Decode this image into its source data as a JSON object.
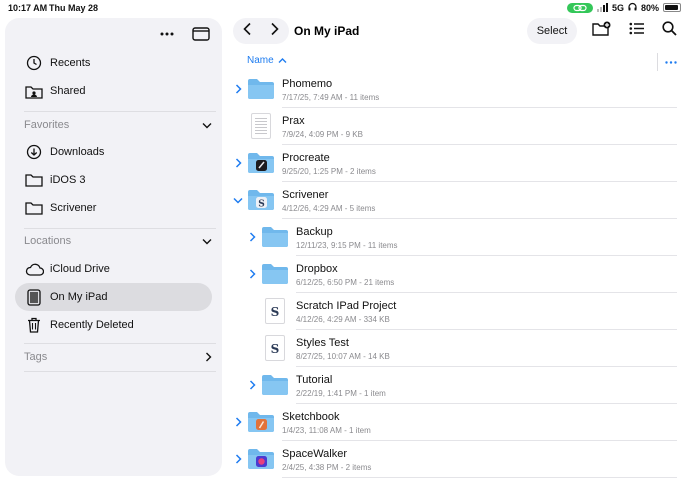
{
  "status": {
    "time": "10:17 AM",
    "date": "Thu May 28",
    "network": "5G",
    "battery": "80%"
  },
  "sidebar": {
    "items_top": [
      {
        "label": "Recents",
        "icon": "clock-icon"
      },
      {
        "label": "Shared",
        "icon": "shared-folder-icon"
      }
    ],
    "favorites": {
      "title": "Favorites",
      "items": [
        {
          "label": "Downloads",
          "icon": "download-icon"
        },
        {
          "label": "iDOS 3",
          "icon": "folder-icon"
        },
        {
          "label": "Scrivener",
          "icon": "folder-icon"
        }
      ]
    },
    "locations": {
      "title": "Locations",
      "items": [
        {
          "label": "iCloud Drive",
          "icon": "cloud-icon"
        },
        {
          "label": "On My iPad",
          "icon": "ipad-icon",
          "selected": true
        },
        {
          "label": "Recently Deleted",
          "icon": "trash-icon"
        }
      ]
    },
    "tags": {
      "title": "Tags"
    }
  },
  "header": {
    "title": "On My iPad",
    "select_label": "Select"
  },
  "sort": {
    "label": "Name"
  },
  "files": [
    {
      "name": "Phomemo",
      "meta": "7/17/25, 7:49 AM - 11 items",
      "kind": "folder",
      "level": 0,
      "expandable": true,
      "expanded": false
    },
    {
      "name": "Prax",
      "meta": "7/9/24, 4:09 PM - 9 KB",
      "kind": "doc",
      "level": 0,
      "expandable": false
    },
    {
      "name": "Procreate",
      "meta": "9/25/20, 1:25 PM - 2 items",
      "kind": "folder-procreate",
      "level": 0,
      "expandable": true,
      "expanded": false
    },
    {
      "name": "Scrivener",
      "meta": "4/12/26, 4:29 AM - 5 items",
      "kind": "folder-scrivener",
      "level": 0,
      "expandable": true,
      "expanded": true
    },
    {
      "name": "Backup",
      "meta": "12/11/23, 9:15 PM - 11 items",
      "kind": "folder",
      "level": 1,
      "expandable": true,
      "expanded": false
    },
    {
      "name": "Dropbox",
      "meta": "6/12/25, 6:50 PM - 21 items",
      "kind": "folder",
      "level": 1,
      "expandable": true,
      "expanded": false
    },
    {
      "name": "Scratch IPad Project",
      "meta": "4/12/26, 4:29 AM - 334 KB",
      "kind": "scriv",
      "level": 1,
      "expandable": false
    },
    {
      "name": "Styles Test",
      "meta": "8/27/25, 10:07 AM - 14 KB",
      "kind": "scriv",
      "level": 1,
      "expandable": false
    },
    {
      "name": "Tutorial",
      "meta": "2/22/19, 1:41 PM - 1 item",
      "kind": "folder",
      "level": 1,
      "expandable": true,
      "expanded": false
    },
    {
      "name": "Sketchbook",
      "meta": "1/4/23, 11:08 AM - 1 item",
      "kind": "folder-sketchbook",
      "level": 0,
      "expandable": true,
      "expanded": false
    },
    {
      "name": "SpaceWalker",
      "meta": "2/4/25, 4:38 PM - 2 items",
      "kind": "folder-spacewalker",
      "level": 0,
      "expandable": true,
      "expanded": false
    }
  ],
  "colors": {
    "accent": "#1e7cf0",
    "folder": "#70b8ec",
    "sidebar_bg": "#f2f2f6",
    "selected_bg": "#dcdce0",
    "status_green": "#34c759"
  }
}
